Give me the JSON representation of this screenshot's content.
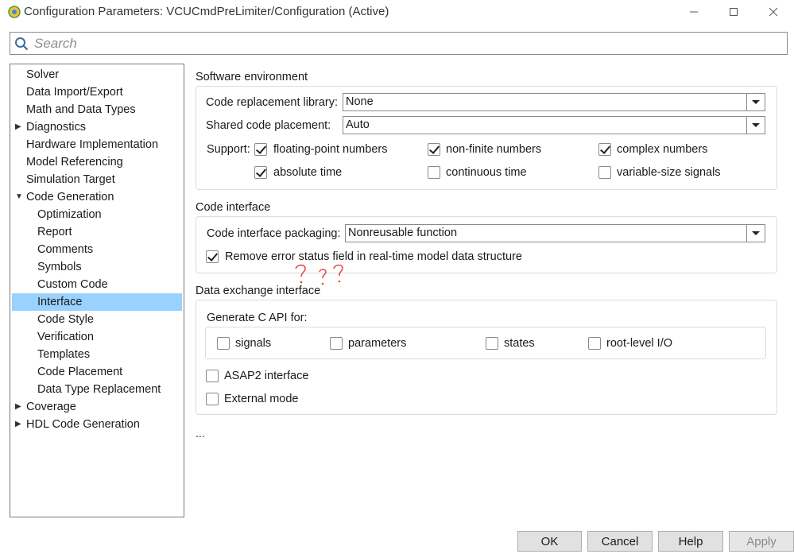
{
  "window": {
    "title": "Configuration Parameters: VCUCmdPreLimiter/Configuration (Active)",
    "icon": "matlab-config-icon",
    "controls": {
      "minimize": "—",
      "maximize": "☐",
      "close": "✕"
    }
  },
  "search": {
    "placeholder": "Search",
    "value": ""
  },
  "tree": {
    "items": [
      {
        "label": "Solver",
        "level": 0,
        "expander": ""
      },
      {
        "label": "Data Import/Export",
        "level": 0,
        "expander": ""
      },
      {
        "label": "Math and Data Types",
        "level": 0,
        "expander": ""
      },
      {
        "label": "Diagnostics",
        "level": 0,
        "expander": "collapsed"
      },
      {
        "label": "Hardware Implementation",
        "level": 0,
        "expander": ""
      },
      {
        "label": "Model Referencing",
        "level": 0,
        "expander": ""
      },
      {
        "label": "Simulation Target",
        "level": 0,
        "expander": ""
      },
      {
        "label": "Code Generation",
        "level": 0,
        "expander": "expanded"
      },
      {
        "label": "Optimization",
        "level": 1,
        "expander": ""
      },
      {
        "label": "Report",
        "level": 1,
        "expander": ""
      },
      {
        "label": "Comments",
        "level": 1,
        "expander": ""
      },
      {
        "label": "Symbols",
        "level": 1,
        "expander": ""
      },
      {
        "label": "Custom Code",
        "level": 1,
        "expander": ""
      },
      {
        "label": "Interface",
        "level": 1,
        "expander": "",
        "selected": true
      },
      {
        "label": "Code Style",
        "level": 1,
        "expander": ""
      },
      {
        "label": "Verification",
        "level": 1,
        "expander": ""
      },
      {
        "label": "Templates",
        "level": 1,
        "expander": ""
      },
      {
        "label": "Code Placement",
        "level": 1,
        "expander": ""
      },
      {
        "label": "Data Type Replacement",
        "level": 1,
        "expander": ""
      },
      {
        "label": "Coverage",
        "level": 0,
        "expander": "collapsed"
      },
      {
        "label": "HDL Code Generation",
        "level": 0,
        "expander": "collapsed"
      }
    ]
  },
  "software_env": {
    "title": "Software environment",
    "code_replacement_label": "Code replacement library:",
    "code_replacement_value": "None",
    "shared_code_label": "Shared code placement:",
    "shared_code_value": "Auto",
    "support_label": "Support:",
    "options": {
      "floating_point": {
        "label": "floating-point numbers",
        "checked": true
      },
      "non_finite": {
        "label": "non-finite numbers",
        "checked": true
      },
      "complex": {
        "label": "complex numbers",
        "checked": true
      },
      "absolute_time": {
        "label": "absolute time",
        "checked": true
      },
      "continuous_time": {
        "label": "continuous time",
        "checked": false
      },
      "variable_size": {
        "label": "variable-size signals",
        "checked": false
      }
    }
  },
  "code_interface": {
    "title": "Code interface",
    "packaging_label": "Code interface packaging:",
    "packaging_value": "Nonreusable function",
    "remove_error_label": "Remove error status field in real-time model data structure",
    "remove_error_checked": true,
    "annotation": "? ? ?"
  },
  "data_exchange": {
    "title": "Data exchange interface",
    "c_api_label": "Generate C API for:",
    "c_api": {
      "signals": {
        "label": "signals",
        "checked": false
      },
      "parameters": {
        "label": "parameters",
        "checked": false
      },
      "states": {
        "label": "states",
        "checked": false
      },
      "root_io": {
        "label": "root-level I/O",
        "checked": false
      }
    },
    "asap2": {
      "label": "ASAP2 interface",
      "checked": false
    },
    "external_mode": {
      "label": "External mode",
      "checked": false
    }
  },
  "more": "...",
  "buttons": {
    "ok": "OK",
    "cancel": "Cancel",
    "help": "Help",
    "apply": "Apply"
  },
  "colors": {
    "selection": "#99d1ff",
    "annotation": "#e8474a",
    "button_face": "#e1e1e1"
  }
}
